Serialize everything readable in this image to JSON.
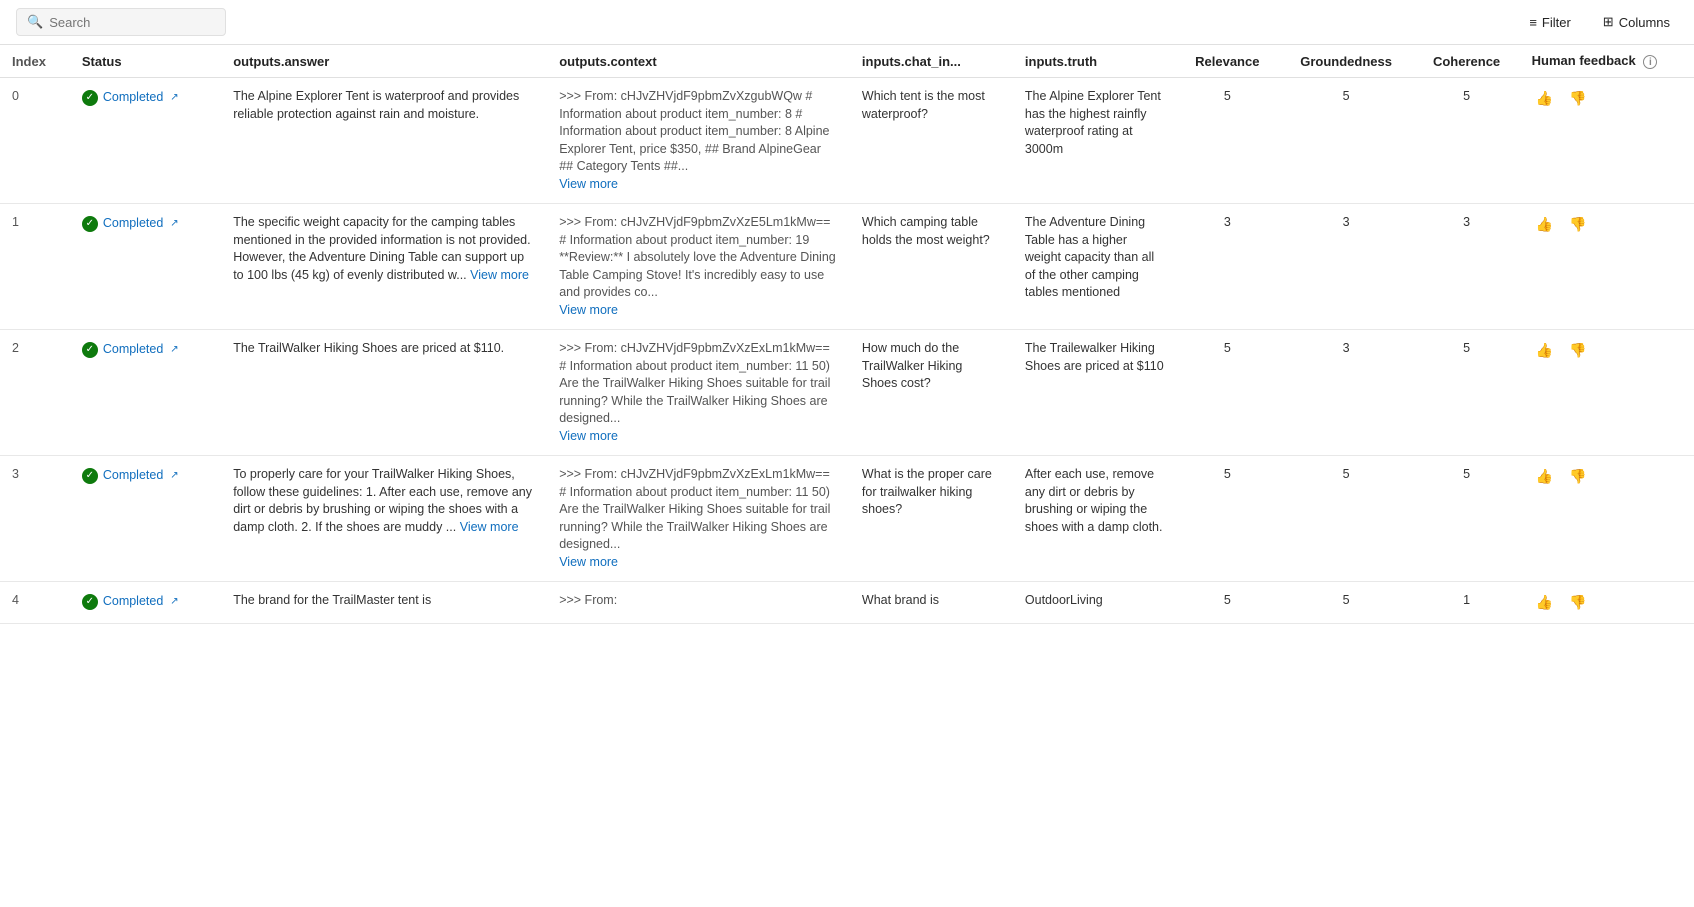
{
  "search": {
    "placeholder": "Search",
    "value": ""
  },
  "toolbar": {
    "filter_label": "Filter",
    "columns_label": "Columns"
  },
  "table": {
    "headers": [
      {
        "key": "index",
        "label": "Index"
      },
      {
        "key": "status",
        "label": "Status"
      },
      {
        "key": "answer",
        "label": "outputs.answer"
      },
      {
        "key": "context",
        "label": "outputs.context"
      },
      {
        "key": "chat_in",
        "label": "inputs.chat_in..."
      },
      {
        "key": "truth",
        "label": "inputs.truth"
      },
      {
        "key": "relevance",
        "label": "Relevance"
      },
      {
        "key": "groundedness",
        "label": "Groundedness"
      },
      {
        "key": "coherence",
        "label": "Coherence"
      },
      {
        "key": "feedback",
        "label": "Human feedback"
      }
    ],
    "rows": [
      {
        "index": "0",
        "status": "Completed",
        "answer": "The Alpine Explorer Tent is waterproof and provides reliable protection against rain and moisture.",
        "context_prefix": ">>> From: cHJvZHVjdF9pbmZvXzgubWQw # Information about product item_number: 8 # Information about product item_number: 8 Alpine Explorer Tent, price $350, ## Brand AlpineGear ## Category Tents ##...",
        "context_has_more": true,
        "chat_in": "Which tent is the most waterproof?",
        "truth": "The Alpine Explorer Tent has the highest rainfly waterproof rating at 3000m",
        "relevance": "5",
        "groundedness": "5",
        "coherence": "5"
      },
      {
        "index": "1",
        "status": "Completed",
        "answer": "The specific weight capacity for the camping tables mentioned in the provided information is not provided. However, the Adventure Dining Table can support up to 100 lbs (45 kg) of evenly distributed w...",
        "answer_has_more": true,
        "context_prefix": ">>> From: cHJvZHVjdF9pbmZvXzE5Lm1kMw== # Information about product item_number: 19 **Review:** I absolutely love the Adventure Dining Table Camping Stove! It's incredibly easy to use and provides co...",
        "context_has_more": true,
        "chat_in": "Which camping table holds the most weight?",
        "truth": "The Adventure Dining Table has a higher weight capacity than all of the other camping tables mentioned",
        "relevance": "3",
        "groundedness": "3",
        "coherence": "3"
      },
      {
        "index": "2",
        "status": "Completed",
        "answer": "The TrailWalker Hiking Shoes are priced at $110.",
        "context_prefix": ">>> From: cHJvZHVjdF9pbmZvXzExLm1kMw== # Information about product item_number: 11 50) Are the TrailWalker Hiking Shoes suitable for trail running? While the TrailWalker Hiking Shoes are designed...",
        "context_has_more": true,
        "chat_in": "How much do the TrailWalker Hiking Shoes cost?",
        "truth": "The Trailewalker Hiking Shoes are priced at $110",
        "relevance": "5",
        "groundedness": "3",
        "coherence": "5"
      },
      {
        "index": "3",
        "status": "Completed",
        "answer": "To properly care for your TrailWalker Hiking Shoes, follow these guidelines: 1. After each use, remove any dirt or debris by brushing or wiping the shoes with a damp cloth. 2. If the shoes are muddy ...",
        "answer_has_more": true,
        "context_prefix": ">>> From: cHJvZHVjdF9pbmZvXzExLm1kMw== # Information about product item_number: 11 50) Are the TrailWalker Hiking Shoes suitable for trail running? While the TrailWalker Hiking Shoes are designed...",
        "context_has_more": true,
        "chat_in": "What is the proper care for trailwalker hiking shoes?",
        "truth": "After each use, remove any dirt or debris by brushing or wiping the shoes with a damp cloth.",
        "relevance": "5",
        "groundedness": "5",
        "coherence": "5"
      },
      {
        "index": "4",
        "status": "Completed",
        "answer": "The brand for the TrailMaster tent is",
        "context_prefix": ">>> From:",
        "context_has_more": false,
        "chat_in": "What brand is",
        "truth": "OutdoorLiving",
        "relevance": "5",
        "groundedness": "5",
        "coherence": "1"
      }
    ]
  }
}
